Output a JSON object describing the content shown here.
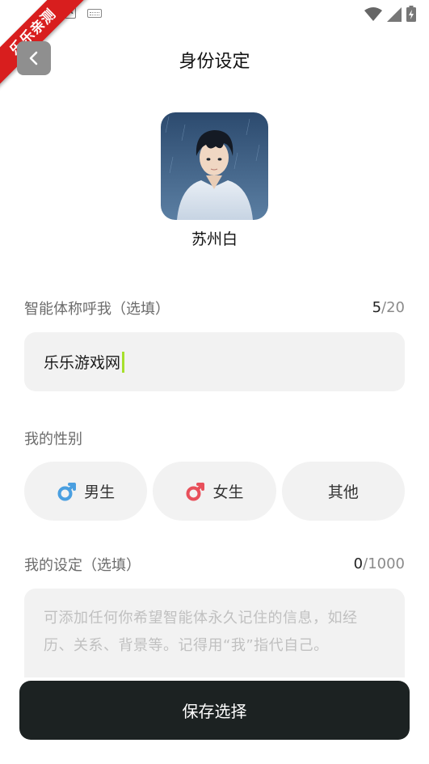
{
  "watermark": {
    "text": "乐乐亲测"
  },
  "status_bar": {
    "a_icon": "A"
  },
  "header": {
    "title": "身份设定",
    "back_icon": "chevron-left-icon"
  },
  "agent": {
    "name": "苏州白"
  },
  "nickname": {
    "label": "智能体称呼我（选填）",
    "count": "5",
    "max": "/20",
    "value": "乐乐游戏网"
  },
  "gender": {
    "label": "我的性别",
    "options": [
      {
        "label": "男生",
        "icon": "male-symbol-icon",
        "icon_color": "#4a9fe0"
      },
      {
        "label": "女生",
        "icon": "female-symbol-icon",
        "icon_color": "#e8505b"
      },
      {
        "label": "其他"
      }
    ]
  },
  "settings": {
    "label": "我的设定（选填）",
    "count": "0",
    "max": "/1000",
    "placeholder": "可添加任何你希望智能体永久记住的信息，如经历、关系、背景等。记得用“我”指代自己。"
  },
  "footer": {
    "save_label": "保存选择"
  },
  "colors": {
    "accent_caret": "#a6e02c",
    "button_dark": "#1c2222",
    "field_bg": "#f2f2f2",
    "ribbon": "#d81e1e"
  }
}
